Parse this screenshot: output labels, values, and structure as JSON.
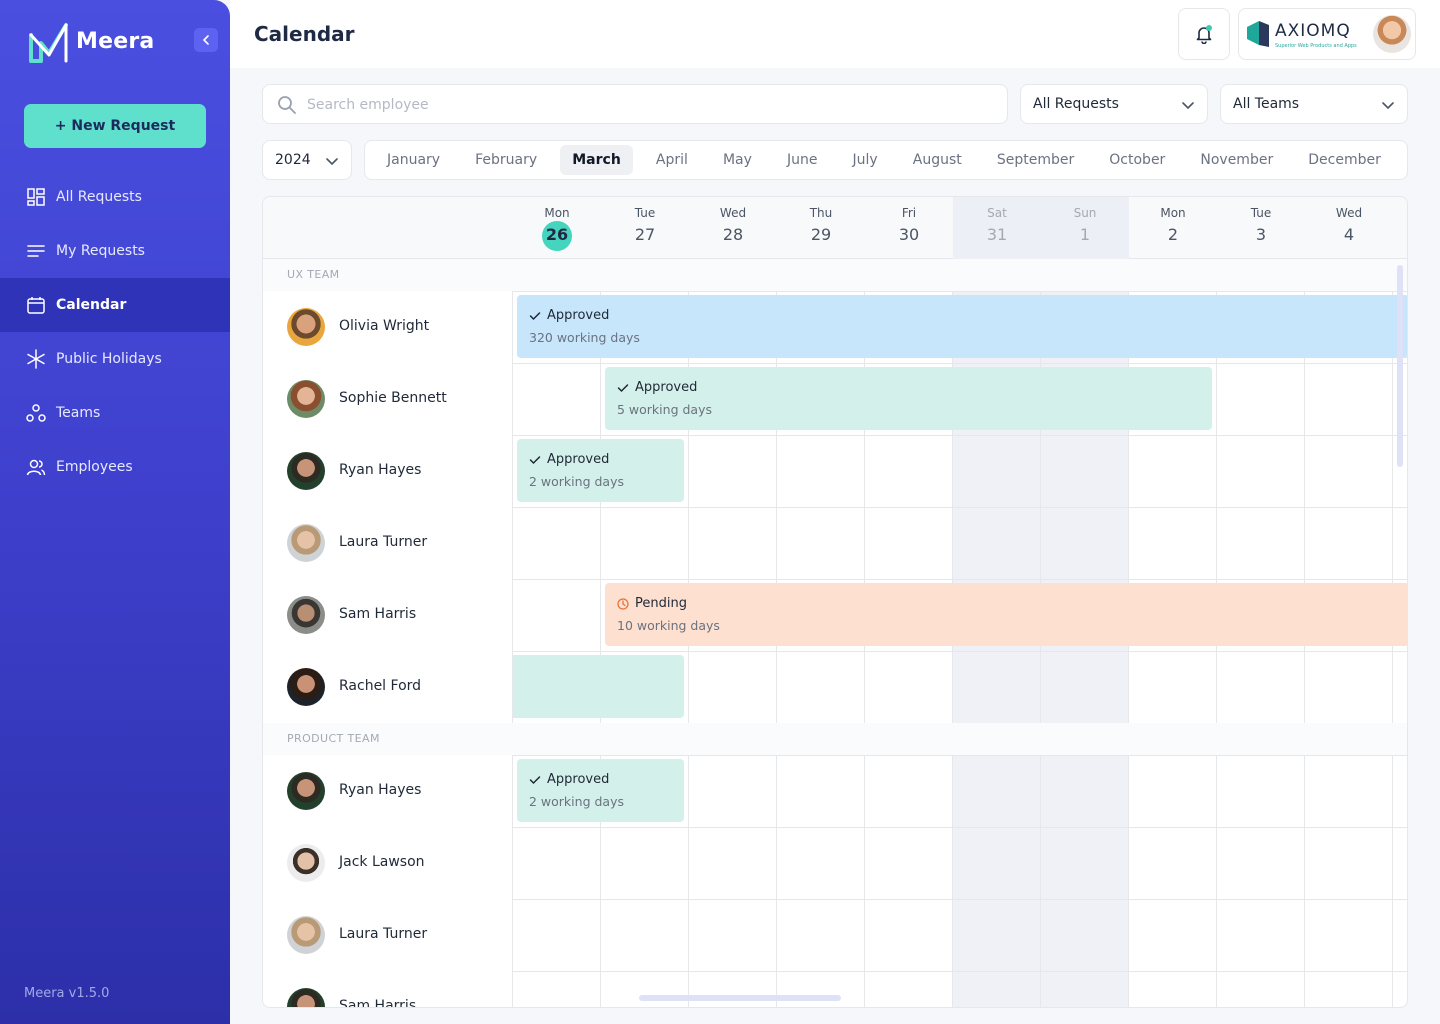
{
  "brand": {
    "name": "Meera",
    "version": "Meera v1.5.0"
  },
  "sidebar": {
    "new_request": "+ New Request",
    "items": [
      {
        "label": "All Requests",
        "icon": "grid-icon"
      },
      {
        "label": "My Requests",
        "icon": "list-icon"
      },
      {
        "label": "Calendar",
        "icon": "calendar-icon",
        "active": true
      },
      {
        "label": "Public Holidays",
        "icon": "snowflake-icon"
      },
      {
        "label": "Teams",
        "icon": "teams-icon"
      },
      {
        "label": "Employees",
        "icon": "users-icon"
      }
    ]
  },
  "header": {
    "title": "Calendar",
    "company": {
      "name": "AXIOMQ",
      "tagline": "Superior Web Products and Apps"
    }
  },
  "filters": {
    "search_placeholder": "Search employee",
    "requests": "All Requests",
    "teams": "All Teams",
    "year": "2024",
    "months": [
      "January",
      "February",
      "March",
      "April",
      "May",
      "June",
      "July",
      "August",
      "September",
      "October",
      "November",
      "December"
    ],
    "active_month": "March"
  },
  "calendar": {
    "days": [
      {
        "name": "Mon",
        "num": "26",
        "today": true
      },
      {
        "name": "Tue",
        "num": "27"
      },
      {
        "name": "Wed",
        "num": "28"
      },
      {
        "name": "Thu",
        "num": "29"
      },
      {
        "name": "Fri",
        "num": "30"
      },
      {
        "name": "Sat",
        "num": "31",
        "weekend": true
      },
      {
        "name": "Sun",
        "num": "1",
        "weekend": true
      },
      {
        "name": "Mon",
        "num": "2"
      },
      {
        "name": "Tue",
        "num": "3"
      },
      {
        "name": "Wed",
        "num": "4"
      }
    ],
    "teams": [
      {
        "label": "UX TEAM",
        "employees": [
          {
            "name": "Olivia Wright"
          },
          {
            "name": "Sophie Bennett"
          },
          {
            "name": "Ryan Hayes"
          },
          {
            "name": "Laura Turner"
          },
          {
            "name": "Sam Harris"
          },
          {
            "name": "Rachel Ford"
          }
        ]
      },
      {
        "label": "PRODUCT TEAM",
        "employees": [
          {
            "name": "Ryan Hayes"
          },
          {
            "name": "Jack Lawson"
          },
          {
            "name": "Laura Turner"
          },
          {
            "name": "Sam Harris"
          }
        ]
      }
    ],
    "requests": [
      {
        "status": "Approved",
        "days": "320 working days",
        "color": "#c7e6fb"
      },
      {
        "status": "Approved",
        "days": "5 working days",
        "color": "#d4f0ea"
      },
      {
        "status": "Approved",
        "days": "2 working days",
        "color": "#d4f0ea"
      },
      {
        "status": "Pending",
        "days": "10 working days",
        "color": "#fde0cf"
      },
      {
        "status": "",
        "days": "",
        "color": "#d4f0ea"
      },
      {
        "status": "Approved",
        "days": "2 working days",
        "color": "#d4f0ea"
      }
    ]
  },
  "colors": {
    "accent": "#45d4bd",
    "sidebar": "#3e40cc",
    "pending": "#e8743b"
  }
}
